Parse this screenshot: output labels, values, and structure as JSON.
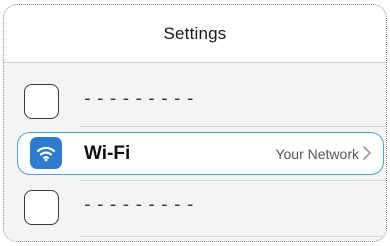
{
  "header": {
    "title": "Settings"
  },
  "rows": [
    {
      "kind": "placeholder",
      "text": "---------"
    },
    {
      "kind": "wifi",
      "label": "Wi-Fi",
      "value": "Your Network",
      "icon": "wifi-icon"
    },
    {
      "kind": "placeholder",
      "text": "---------"
    }
  ],
  "colors": {
    "accent": "#2e7bd0",
    "highlight_border": "#4aa6d6"
  }
}
